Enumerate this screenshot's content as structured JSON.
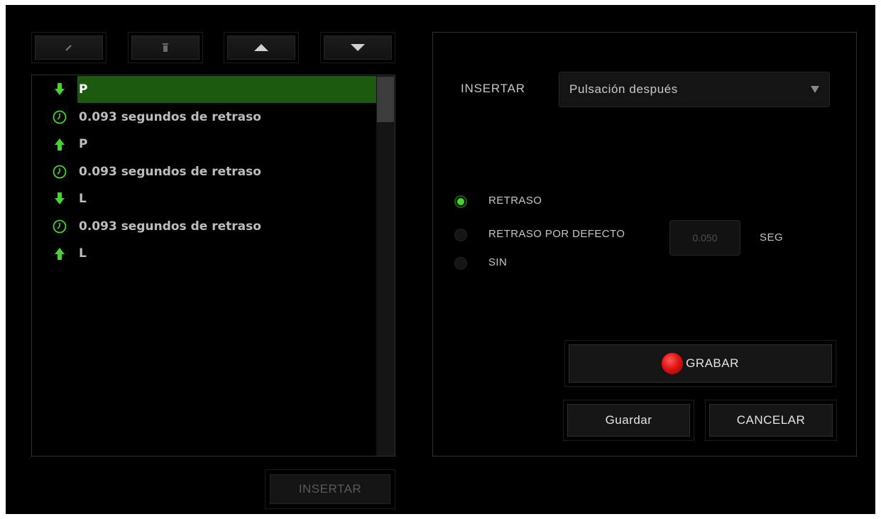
{
  "toolbar": {
    "edit_icon": "pencil-icon",
    "delete_icon": "trash-icon",
    "up_icon": "triangle-up-icon",
    "down_icon": "triangle-down-icon"
  },
  "macro_list": {
    "items": [
      {
        "icon": "arrow-down-icon",
        "text": "P",
        "selected": true
      },
      {
        "icon": "clock-icon",
        "text": "0.093 segundos de retraso",
        "selected": false
      },
      {
        "icon": "arrow-up-icon",
        "text": "P",
        "selected": false
      },
      {
        "icon": "clock-icon",
        "text": "0.093 segundos de retraso",
        "selected": false
      },
      {
        "icon": "arrow-down-icon",
        "text": "L",
        "selected": false
      },
      {
        "icon": "clock-icon",
        "text": "0.093 segundos de retraso",
        "selected": false
      },
      {
        "icon": "arrow-up-icon",
        "text": "L",
        "selected": false
      }
    ],
    "insert_button_label": "INSERTAR"
  },
  "right_panel": {
    "insert_label": "INSERTAR",
    "insert_select_value": "Pulsación después",
    "delay_options": {
      "retraso": "RETRASO",
      "retraso_por_defecto": "RETRASO POR DEFECTO",
      "sin": "SIN",
      "selected": "RETRASO"
    },
    "default_delay_value": "0.050",
    "unit_label": "SEG",
    "record_button_label": "GRABAR",
    "save_button_label": "Guardar",
    "cancel_button_label": "CANCELAR"
  },
  "colors": {
    "accent_green": "#44d62c",
    "selection_bg": "#1b5a0f",
    "record_red": "#e01414"
  }
}
